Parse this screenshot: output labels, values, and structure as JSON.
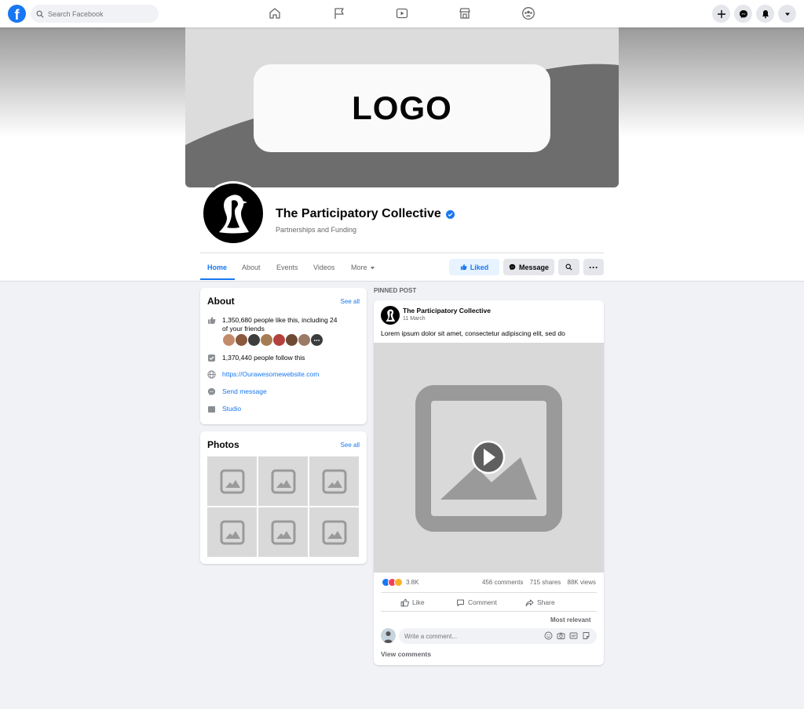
{
  "topbar": {
    "logo_letter": "f",
    "search_placeholder": "Search Facebook",
    "nav": [
      "home-icon",
      "flag-icon",
      "watch-icon",
      "marketplace-icon",
      "groups-icon"
    ],
    "right": [
      "plus-icon",
      "messenger-icon",
      "notifications-icon",
      "account-menu-icon"
    ]
  },
  "cover": {
    "logo_text": "LOGO"
  },
  "page": {
    "name": "The Participatory Collective",
    "category": "Partnerships and Funding",
    "verified": true
  },
  "tabs": {
    "home": "Home",
    "about": "About",
    "events": "Events",
    "videos": "Videos",
    "more": "More"
  },
  "actions": {
    "liked": "Liked",
    "message": "Message",
    "more": "···"
  },
  "about": {
    "title": "About",
    "see_all": "See all",
    "likes_line1": "1,350,680 people like this, including 24",
    "likes_line2": "of your friends",
    "follows": "1,370,440 people follow this",
    "website": "https://Ourawesomewebsite.com",
    "send_message": "Send message",
    "studio": "Studio"
  },
  "photos": {
    "title": "Photos",
    "see_all": "See all"
  },
  "post": {
    "pinned_label": "PINNED POST",
    "author": "The Participatory Collective",
    "date": "11 March",
    "text": "Lorem ipsum dolor sit amet, consectetur adipiscing elit, sed do",
    "reactions_count": "3.8K",
    "comments": "456 comments",
    "shares": "715 shares",
    "views": "88K views",
    "like_label": "Like",
    "comment_label": "Comment",
    "share_label": "Share",
    "sort_label": "Most relevant",
    "comment_placeholder": "Write a comment...",
    "view_comments": "View comments"
  },
  "colors": {
    "brand_blue": "#1877f2",
    "page_bg": "#f0f2f5",
    "like_blue": "#1877f2",
    "love_red": "#f33e58",
    "wow_yellow": "#f7b125"
  }
}
